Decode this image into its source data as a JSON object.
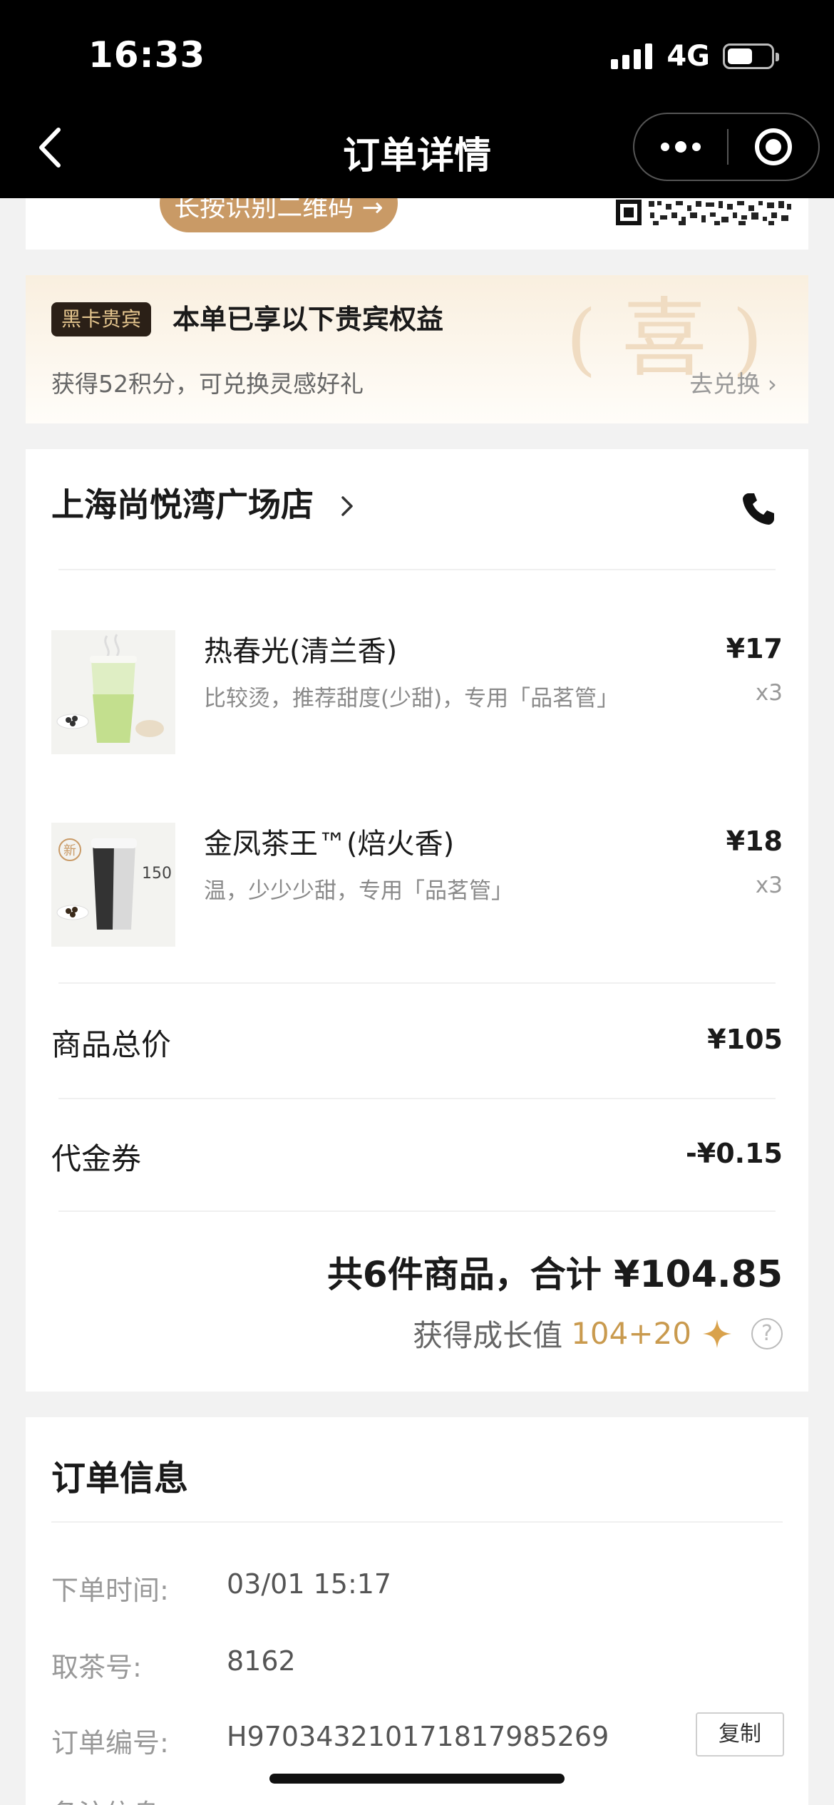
{
  "status_bar": {
    "time": "16:33",
    "network": "4G",
    "battery_level": 0.5
  },
  "nav": {
    "title": "订单详情"
  },
  "qr_section": {
    "button_label": "长按识别二维码 →"
  },
  "vip": {
    "badge": "黑卡贵宾",
    "title": "本单已享以下贵宾权益",
    "subtitle": "获得52积分，可兑换灵感好礼",
    "link": "去兑换 ›",
    "watermark": "喜"
  },
  "store": {
    "name": "上海尚悦湾广场店"
  },
  "items": [
    {
      "name": "热春光(清兰香)",
      "spec": "比较烫，推荐甜度(少甜)，专用「品茗管」",
      "price": "¥17",
      "qty": "x3"
    },
    {
      "name": "金凤茶王™(焙火香)",
      "spec": "温，少少少甜，专用「品茗管」",
      "price": "¥18",
      "qty": "x3",
      "image_tag": "新",
      "image_label": "150"
    }
  ],
  "summary": {
    "subtotal_label": "商品总价",
    "subtotal_value": "¥105",
    "voucher_label": "代金券",
    "voucher_value": "-¥0.15",
    "total_prefix": "共6件商品，合计",
    "total_value": "¥104.85",
    "growth_label": "获得成长值",
    "growth_value": "104+20",
    "help_glyph": "?"
  },
  "order_info": {
    "title": "订单信息",
    "rows": [
      {
        "label": "下单时间:",
        "value": "03/01 15:17"
      },
      {
        "label": "取茶号:",
        "value": "8162"
      },
      {
        "label": "订单编号:",
        "value": "H970343210171817985269"
      },
      {
        "label": "备注信息"
      }
    ],
    "copy_label": "复制"
  },
  "icons": {
    "back": "back-chevron-icon",
    "more": "more-dots-icon",
    "mini_program": "target-icon",
    "phone": "phone-icon",
    "spark": "sparkle-icon",
    "help": "help-circle-icon"
  },
  "colors": {
    "accent_gold": "#c99a4e",
    "button_gold": "#c99a66",
    "vip_badge_bg": "#2b2017"
  }
}
